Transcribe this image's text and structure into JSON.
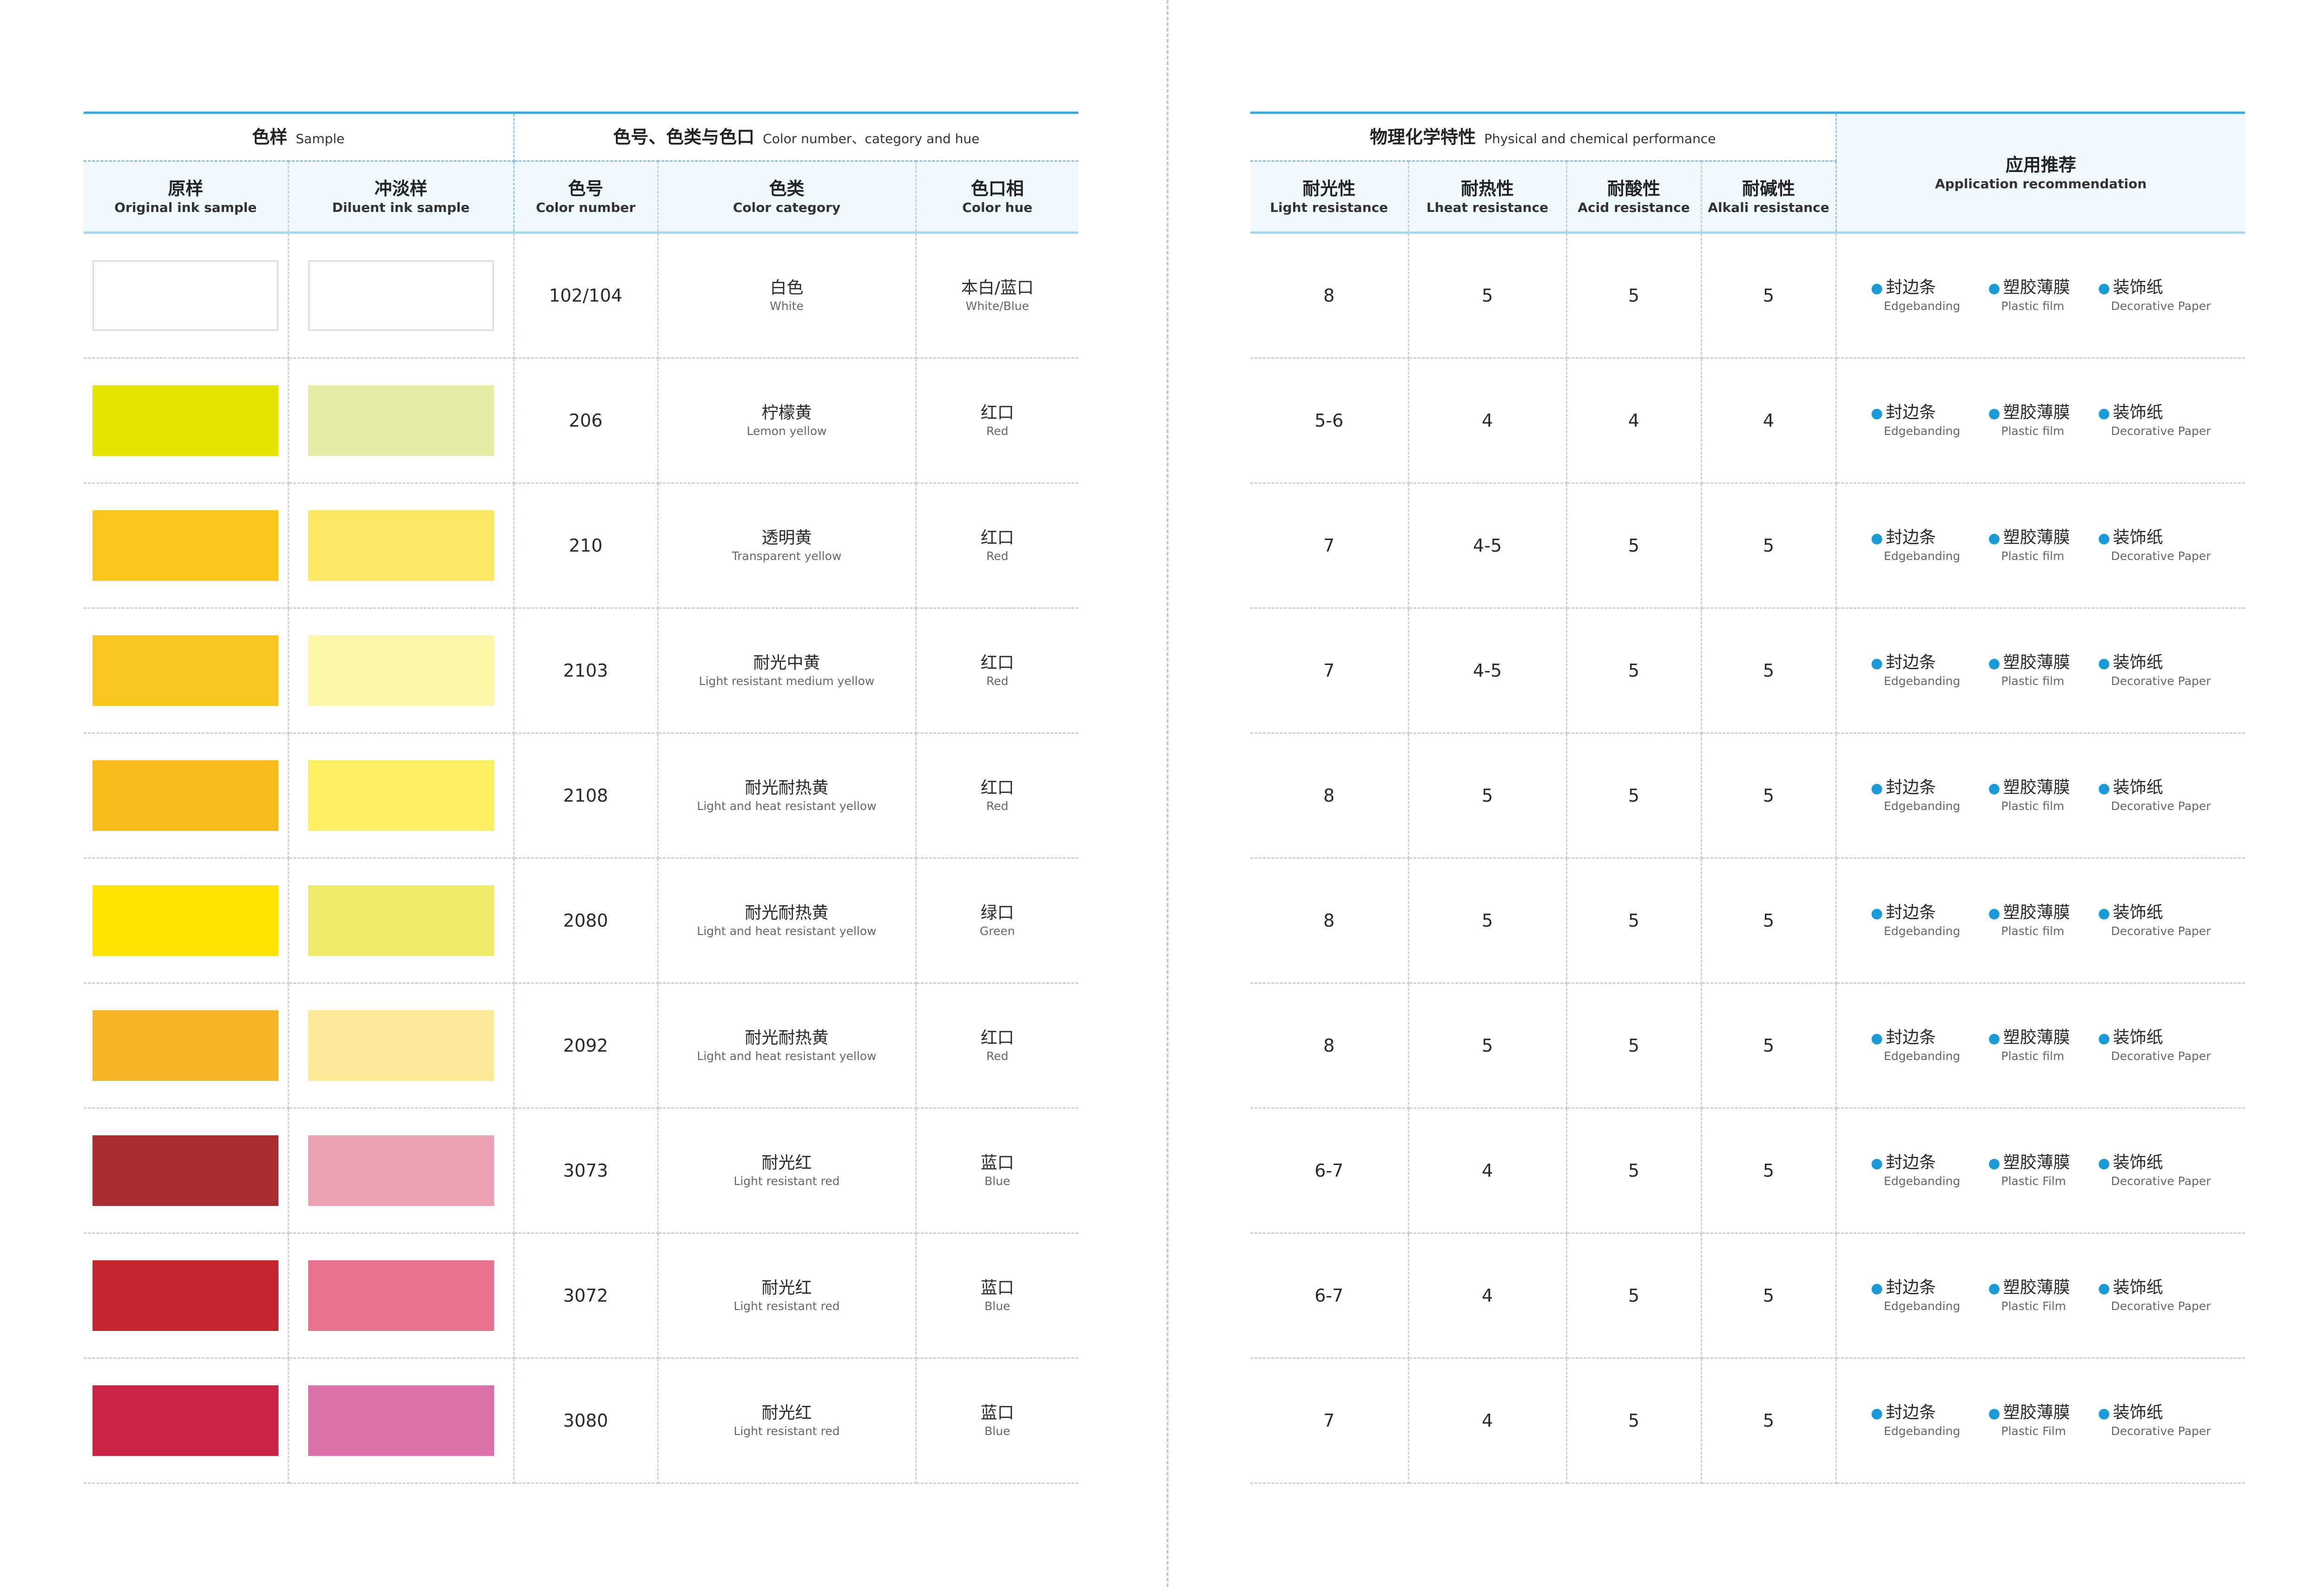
{
  "left": {
    "group_headers": {
      "sample_zh": "色样",
      "sample_en": "Sample",
      "color_zh": "色号、色类与色口",
      "color_en": "Color number、category and hue"
    },
    "columns": {
      "original_zh": "原样",
      "original_en": "Original ink sample",
      "diluent_zh": "冲淡样",
      "diluent_en": "Diluent ink sample",
      "number_zh": "色号",
      "number_en": "Color number",
      "category_zh": "色类",
      "category_en": "Color category",
      "hue_zh": "色口相",
      "hue_en": "Color hue"
    }
  },
  "right": {
    "group_headers": {
      "perf_zh": "物理化学特性",
      "perf_en": "Physical and chemical performance",
      "app_zh": "应用推荐",
      "app_en": "Application recommendation"
    },
    "columns": {
      "light_zh": "耐光性",
      "light_en": "Light resistance",
      "heat_zh": "耐热性",
      "heat_en": "Lheat resistance",
      "acid_zh": "耐酸性",
      "acid_en": "Acid resistance",
      "alkali_zh": "耐碱性",
      "alkali_en": "Alkali  resistance"
    }
  },
  "colors": {
    "accent_blue": "#3fa9d8",
    "header_bg": "#f2f9fd",
    "bullet_blue": "#1a9bd7"
  },
  "rows": [
    {
      "original": "#ffffff",
      "diluent": "#ffffff",
      "blank": true,
      "number": "102/104",
      "category_zh": "白色",
      "category_en": "White",
      "hue_zh": "本白/蓝口",
      "hue_en": "White/Blue",
      "light": "8",
      "heat": "5",
      "acid": "5",
      "alkali": "5",
      "apps": [
        {
          "zh": "封边条",
          "en": "Edgebanding"
        },
        {
          "zh": "塑胶薄膜",
          "en": "Plastic film"
        },
        {
          "zh": "装饰纸",
          "en": "Decorative Paper"
        }
      ]
    },
    {
      "original": "#e5e400",
      "diluent": "#e4eca6",
      "number": "206",
      "category_zh": "柠檬黄",
      "category_en": "Lemon yellow",
      "hue_zh": "红口",
      "hue_en": "Red",
      "light": "5-6",
      "heat": "4",
      "acid": "4",
      "alkali": "4",
      "apps": [
        {
          "zh": "封边条",
          "en": "Edgebanding"
        },
        {
          "zh": "塑胶薄膜",
          "en": "Plastic film"
        },
        {
          "zh": "装饰纸",
          "en": "Decorative Paper"
        }
      ]
    },
    {
      "original": "#fbc51c",
      "diluent": "#fbe862",
      "number": "210",
      "category_zh": "透明黄",
      "category_en": "Transparent yellow",
      "hue_zh": "红口",
      "hue_en": "Red",
      "light": "7",
      "heat": "4-5",
      "acid": "5",
      "alkali": "5",
      "apps": [
        {
          "zh": "封边条",
          "en": "Edgebanding"
        },
        {
          "zh": "塑胶薄膜",
          "en": "Plastic film"
        },
        {
          "zh": "装饰纸",
          "en": "Decorative Paper"
        }
      ]
    },
    {
      "original": "#fbc520",
      "diluent": "#fdf7a8",
      "number": "2103",
      "category_zh": "耐光中黄",
      "category_en": "Light resistant medium yellow",
      "hue_zh": "红口",
      "hue_en": "Red",
      "light": "7",
      "heat": "4-5",
      "acid": "5",
      "alkali": "5",
      "apps": [
        {
          "zh": "封边条",
          "en": "Edgebanding"
        },
        {
          "zh": "塑胶薄膜",
          "en": "Plastic film"
        },
        {
          "zh": "装饰纸",
          "en": "Decorative Paper"
        }
      ]
    },
    {
      "original": "#f9bb1b",
      "diluent": "#fcf062",
      "number": "2108",
      "category_zh": "耐光耐热黄",
      "category_en": "Light and heat resistant yellow",
      "hue_zh": "红口",
      "hue_en": "Red",
      "light": "8",
      "heat": "5",
      "acid": "5",
      "alkali": "5",
      "apps": [
        {
          "zh": "封边条",
          "en": "Edgebanding"
        },
        {
          "zh": "塑胶薄膜",
          "en": "Plastic film"
        },
        {
          "zh": "装饰纸",
          "en": "Decorative Paper"
        }
      ]
    },
    {
      "original": "#ffe400",
      "diluent": "#f0ea6a",
      "number": "2080",
      "category_zh": "耐光耐热黄",
      "category_en": "Light and heat resistant yellow",
      "hue_zh": "绿口",
      "hue_en": "Green",
      "light": "8",
      "heat": "5",
      "acid": "5",
      "alkali": "5",
      "apps": [
        {
          "zh": "封边条",
          "en": "Edgebanding"
        },
        {
          "zh": "塑胶薄膜",
          "en": "Plastic film"
        },
        {
          "zh": "装饰纸",
          "en": "Decorative Paper"
        }
      ]
    },
    {
      "original": "#f7b424",
      "diluent": "#fdea98",
      "number": "2092",
      "category_zh": "耐光耐热黄",
      "category_en": "Light and heat resistant yellow",
      "hue_zh": "红口",
      "hue_en": "Red",
      "light": "8",
      "heat": "5",
      "acid": "5",
      "alkali": "5",
      "apps": [
        {
          "zh": "封边条",
          "en": "Edgebanding"
        },
        {
          "zh": "塑胶薄膜",
          "en": "Plastic film"
        },
        {
          "zh": "装饰纸",
          "en": "Decorative Paper"
        }
      ]
    },
    {
      "original": "#ab2d34",
      "diluent": "#eca2b3",
      "number": "3073",
      "category_zh": "耐光红",
      "category_en": "Light resistant red",
      "hue_zh": "蓝口",
      "hue_en": "Blue",
      "light": "6-7",
      "heat": "4",
      "acid": "5",
      "alkali": "5",
      "apps": [
        {
          "zh": "封边条",
          "en": "Edgebanding"
        },
        {
          "zh": "塑胶薄膜",
          "en": "Plastic Film"
        },
        {
          "zh": "装饰纸",
          "en": "Decorative Paper"
        }
      ]
    },
    {
      "original": "#c4262f",
      "diluent": "#ea7090",
      "number": "3072",
      "category_zh": "耐光红",
      "category_en": "Light resistant red",
      "hue_zh": "蓝口",
      "hue_en": "Blue",
      "light": "6-7",
      "heat": "4",
      "acid": "5",
      "alkali": "5",
      "apps": [
        {
          "zh": "封边条",
          "en": "Edgebanding"
        },
        {
          "zh": "塑胶薄膜",
          "en": "Plastic Film"
        },
        {
          "zh": "装饰纸",
          "en": "Decorative Paper"
        }
      ]
    },
    {
      "original": "#cb2545",
      "diluent": "#dc70a8",
      "number": "3080",
      "category_zh": "耐光红",
      "category_en": "Light resistant red",
      "hue_zh": "蓝口",
      "hue_en": "Blue",
      "light": "7",
      "heat": "4",
      "acid": "5",
      "alkali": "5",
      "apps": [
        {
          "zh": "封边条",
          "en": "Edgebanding"
        },
        {
          "zh": "塑胶薄膜",
          "en": "Plastic Film"
        },
        {
          "zh": "装饰纸",
          "en": "Decorative Paper"
        }
      ]
    }
  ]
}
